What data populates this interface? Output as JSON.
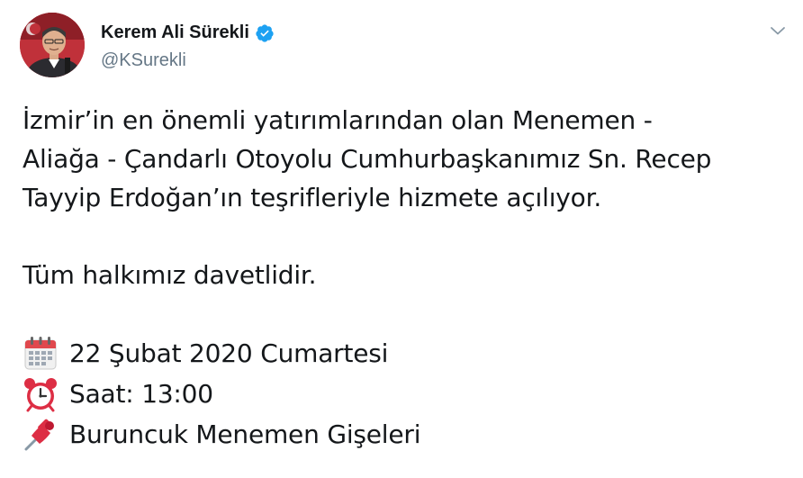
{
  "author": {
    "name": "Kerem Ali Sürekli",
    "handle": "@KSurekli",
    "verified": true,
    "verified_color": "#1da1f2",
    "avatar_icon": "profile-photo"
  },
  "menu": {
    "icon": "chevron-down-icon"
  },
  "tweet": {
    "lines": [
      "İzmir’in en önemli yatırımlarından olan Menemen -",
      "Aliağa - Çandarlı Otoyolu Cumhurbaşkanımız Sn. Recep",
      "Tayyip Erdoğan’ın teşrifleriyle hizmete açılıyor."
    ],
    "invitation": "Tüm halkımız davetlidir.",
    "details": [
      {
        "icon": "calendar-icon",
        "text": "22 Şubat 2020 Cumartesi"
      },
      {
        "icon": "alarm-clock-icon",
        "text": "Saat: 13:00"
      },
      {
        "icon": "pushpin-icon",
        "text": "Buruncuk Menemen Gişeleri"
      }
    ]
  },
  "colors": {
    "text": "#14171a",
    "secondary": "#657786",
    "accent": "#1da1f2"
  }
}
